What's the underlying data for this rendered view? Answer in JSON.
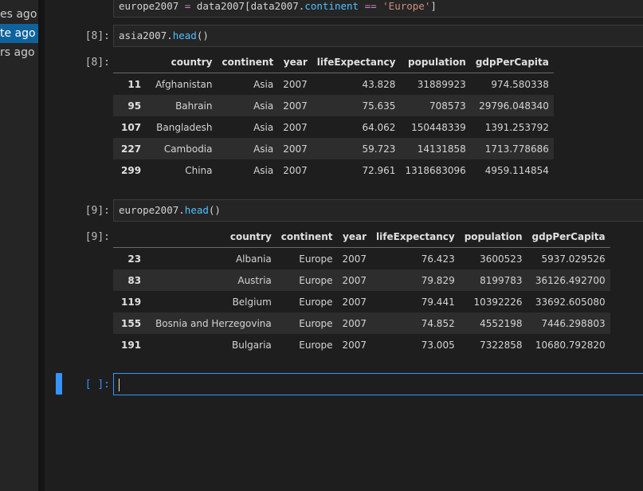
{
  "sidebar": {
    "items": [
      {
        "label": "es ago"
      },
      {
        "label": "te ago"
      },
      {
        "label": "rs ago"
      }
    ]
  },
  "cells": {
    "top_input": {
      "tokens": {
        "a": "europe2007",
        "b": " = ",
        "c": "data2007[data2007.",
        "d": "continent",
        "e": " == ",
        "f": "'Europe'",
        "g": "]"
      }
    },
    "cell8": {
      "prompt_in": "[8]:",
      "prompt_out": "[8]:",
      "code_var": "asia2007.",
      "code_fn": "head",
      "code_paren": "()",
      "table": {
        "columns": [
          "country",
          "continent",
          "year",
          "lifeExpectancy",
          "population",
          "gdpPerCapita"
        ],
        "rows": [
          {
            "index": "11",
            "country": "Afghanistan",
            "continent": "Asia",
            "year": "2007",
            "lifeExpectancy": "43.828",
            "population": "31889923",
            "gdpPerCapita": "974.580338"
          },
          {
            "index": "95",
            "country": "Bahrain",
            "continent": "Asia",
            "year": "2007",
            "lifeExpectancy": "75.635",
            "population": "708573",
            "gdpPerCapita": "29796.048340"
          },
          {
            "index": "107",
            "country": "Bangladesh",
            "continent": "Asia",
            "year": "2007",
            "lifeExpectancy": "64.062",
            "population": "150448339",
            "gdpPerCapita": "1391.253792"
          },
          {
            "index": "227",
            "country": "Cambodia",
            "continent": "Asia",
            "year": "2007",
            "lifeExpectancy": "59.723",
            "population": "14131858",
            "gdpPerCapita": "1713.778686"
          },
          {
            "index": "299",
            "country": "China",
            "continent": "Asia",
            "year": "2007",
            "lifeExpectancy": "72.961",
            "population": "1318683096",
            "gdpPerCapita": "4959.114854"
          }
        ]
      }
    },
    "cell9": {
      "prompt_in": "[9]:",
      "prompt_out": "[9]:",
      "code_var": "europe2007.",
      "code_fn": "head",
      "code_paren": "()",
      "table": {
        "columns": [
          "country",
          "continent",
          "year",
          "lifeExpectancy",
          "population",
          "gdpPerCapita"
        ],
        "rows": [
          {
            "index": "23",
            "country": "Albania",
            "continent": "Europe",
            "year": "2007",
            "lifeExpectancy": "76.423",
            "population": "3600523",
            "gdpPerCapita": "5937.029526"
          },
          {
            "index": "83",
            "country": "Austria",
            "continent": "Europe",
            "year": "2007",
            "lifeExpectancy": "79.829",
            "population": "8199783",
            "gdpPerCapita": "36126.492700"
          },
          {
            "index": "119",
            "country": "Belgium",
            "continent": "Europe",
            "year": "2007",
            "lifeExpectancy": "79.441",
            "population": "10392226",
            "gdpPerCapita": "33692.605080"
          },
          {
            "index": "155",
            "country": "Bosnia and Herzegovina",
            "continent": "Europe",
            "year": "2007",
            "lifeExpectancy": "74.852",
            "population": "4552198",
            "gdpPerCapita": "7446.298803"
          },
          {
            "index": "191",
            "country": "Bulgaria",
            "continent": "Europe",
            "year": "2007",
            "lifeExpectancy": "73.005",
            "population": "7322858",
            "gdpPerCapita": "10680.792820"
          }
        ]
      }
    },
    "empty_cell": {
      "prompt_in": "[ ]:",
      "value": ""
    }
  },
  "colors": {
    "accent": "#3794ff",
    "background": "#1e1e1e",
    "sidebar_active": "#0e639c"
  }
}
